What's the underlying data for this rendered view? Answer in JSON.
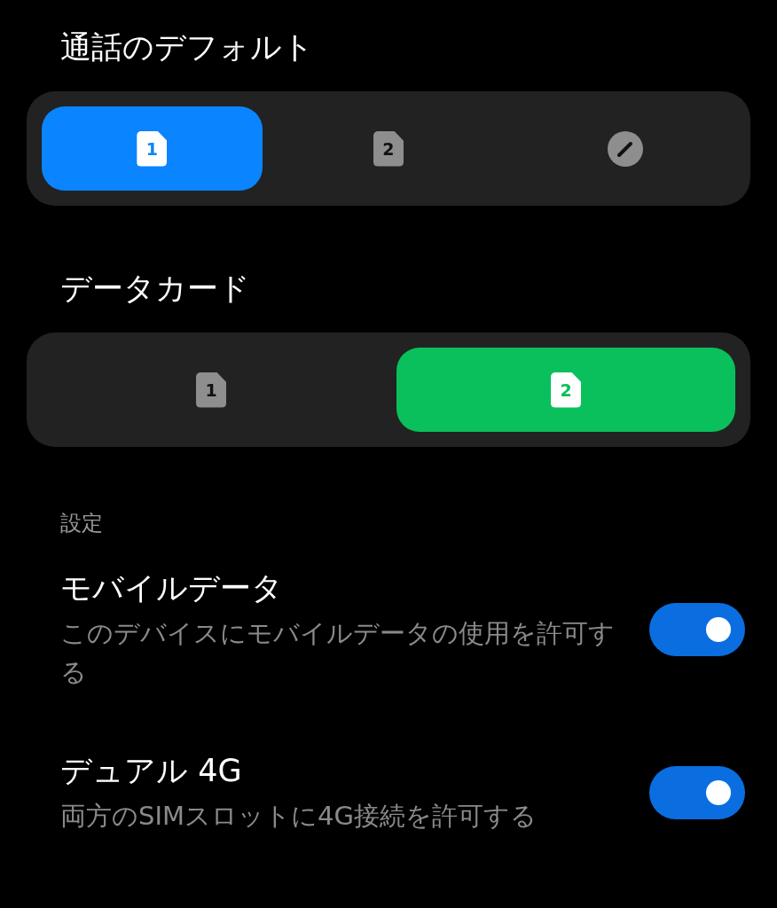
{
  "sections": [
    {
      "title": "通話のデフォルト",
      "color": "#0a84ff",
      "options": [
        {
          "kind": "sim",
          "label": "1",
          "selected": true
        },
        {
          "kind": "sim",
          "label": "2",
          "selected": false
        },
        {
          "kind": "edit",
          "selected": false
        }
      ]
    },
    {
      "title": "データカード",
      "color": "#0ac05c",
      "options": [
        {
          "kind": "sim",
          "label": "1",
          "selected": false
        },
        {
          "kind": "sim",
          "label": "2",
          "selected": true
        }
      ]
    }
  ],
  "settings": {
    "header": "設定",
    "items": [
      {
        "title": "モバイルデータ",
        "description": "このデバイスにモバイルデータの使用を許可する",
        "on": true
      },
      {
        "title": "デュアル 4G",
        "description": "両方のSIMスロットに4G接続を許可する",
        "on": true
      }
    ]
  }
}
